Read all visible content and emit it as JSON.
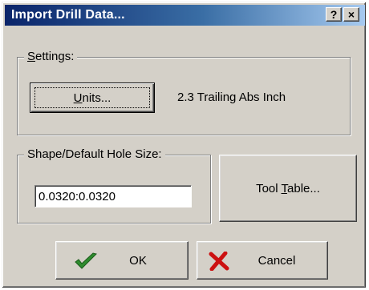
{
  "window": {
    "title": "Import Drill Data...",
    "help_label": "?",
    "close_label": "×"
  },
  "settings": {
    "group_label_u": "S",
    "group_label_rest": "ettings:",
    "units_button_u": "U",
    "units_button_rest": "nits...",
    "units_value": "2.3 Trailing Abs Inch"
  },
  "hole": {
    "group_label": "Shape/Default Hole Size:",
    "value": "0.0320:0.0320"
  },
  "tool_table": {
    "label_pre": "Tool ",
    "label_u": "T",
    "label_post": "able..."
  },
  "actions": {
    "ok_label": "OK",
    "cancel_label": "Cancel"
  },
  "icons": {
    "ok_icon": "checkmark-icon",
    "cancel_icon": "x-mark-icon"
  },
  "colors": {
    "check_green": "#2e8b2e",
    "x_red": "#cc1111"
  }
}
